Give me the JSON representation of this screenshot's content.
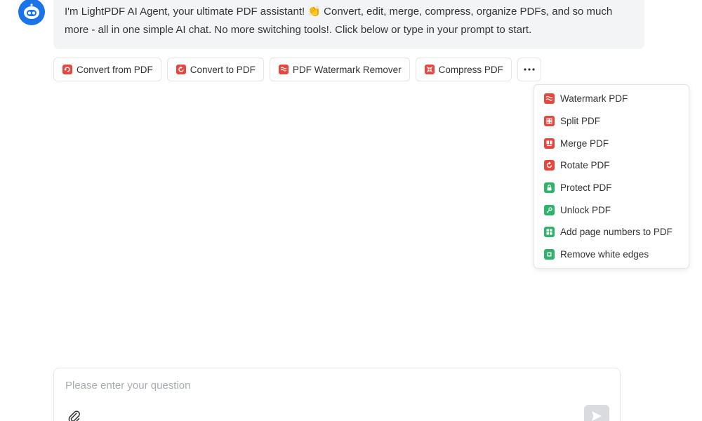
{
  "bot": {
    "avatar_icon": "robot-icon",
    "message": "I'm LightPDF AI Agent, your ultimate PDF assistant! 👏 Convert, edit, merge, compress, organize PDFs, and so much more - all in one simple AI chat. No more switching tools!. Click below or type in your prompt to start."
  },
  "quick_actions": [
    {
      "label": "Convert from PDF",
      "icon": "convert-from-pdf-icon",
      "color": "#e8453c"
    },
    {
      "label": "Convert to PDF",
      "icon": "convert-to-pdf-icon",
      "color": "#e8453c"
    },
    {
      "label": "PDF Watermark Remover",
      "icon": "watermark-remover-icon",
      "color": "#e8453c"
    },
    {
      "label": "Compress PDF",
      "icon": "compress-pdf-icon",
      "color": "#e8453c"
    }
  ],
  "more_button": {
    "icon": "more-dots-icon"
  },
  "more_menu": [
    {
      "label": "Watermark PDF",
      "icon": "watermark-icon",
      "color": "#e8453c"
    },
    {
      "label": "Split PDF",
      "icon": "split-icon",
      "color": "#e8453c"
    },
    {
      "label": "Merge PDF",
      "icon": "merge-icon",
      "color": "#e8453c"
    },
    {
      "label": "Rotate PDF",
      "icon": "rotate-icon",
      "color": "#e8453c"
    },
    {
      "label": "Protect PDF",
      "icon": "lock-icon",
      "color": "#2fb36b"
    },
    {
      "label": "Unlock PDF",
      "icon": "unlock-icon",
      "color": "#2fb36b"
    },
    {
      "label": "Add page numbers to PDF",
      "icon": "page-numbers-icon",
      "color": "#2fb36b"
    },
    {
      "label": "Remove white edges",
      "icon": "crop-icon",
      "color": "#2fb36b"
    }
  ],
  "input": {
    "placeholder": "Please enter your question",
    "value": "",
    "attach_icon": "paperclip-icon",
    "send_icon": "send-icon"
  },
  "colors": {
    "brand_blue": "#1a73e8",
    "red_accent": "#e8453c",
    "green_accent": "#2fb36b"
  }
}
